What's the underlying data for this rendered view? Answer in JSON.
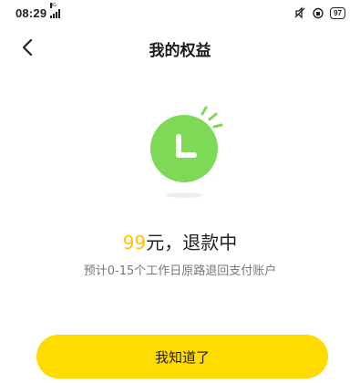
{
  "status_bar": {
    "time": "08:29",
    "network": "4G",
    "battery": "97"
  },
  "header": {
    "title": "我的权益"
  },
  "result": {
    "amount": "99",
    "amount_suffix": "元，退款中",
    "note": "预计0-15个工作日原路退回支付账户"
  },
  "actions": {
    "confirm_label": "我知道了"
  },
  "colors": {
    "accent_yellow": "#ffdb00",
    "amount_yellow": "#ffc300",
    "clock_green": "#7ed957"
  },
  "icons": {
    "back": "chevron-left-icon",
    "illustration": "clock-icon"
  }
}
